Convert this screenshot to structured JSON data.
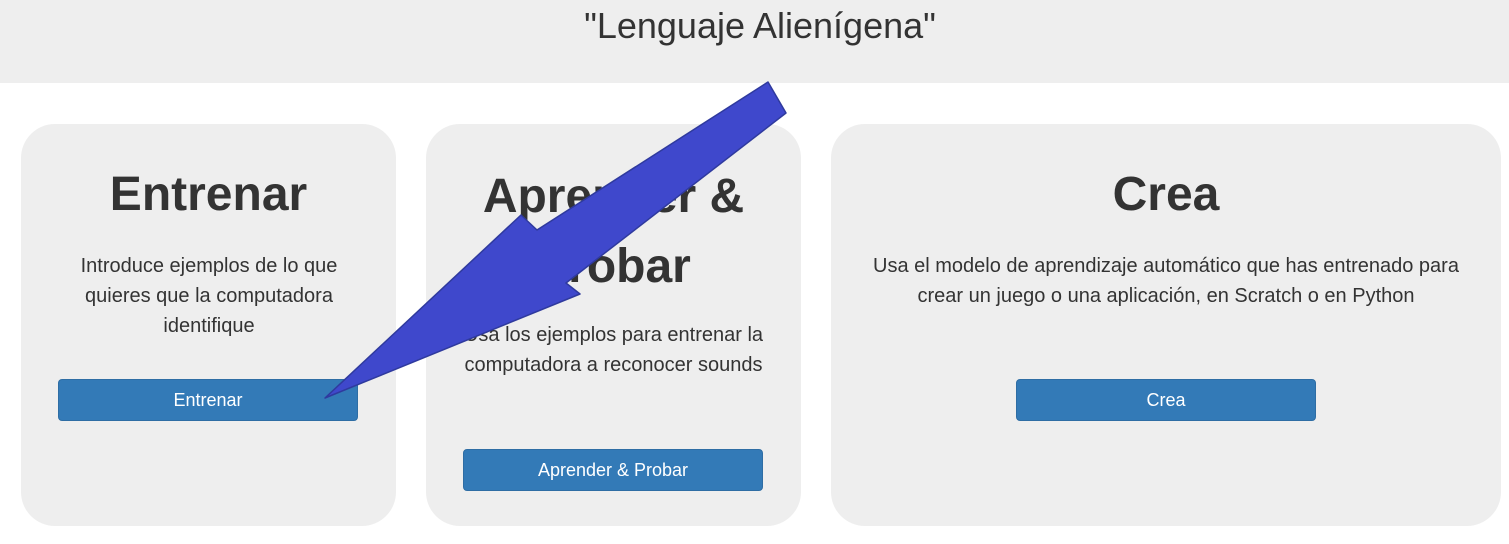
{
  "header": {
    "title": "\"Lenguaje Alienígena\""
  },
  "cards": [
    {
      "title": "Entrenar",
      "description": "Introduce ejemplos de lo que quieres que la computadora identifique",
      "button_label": "Entrenar"
    },
    {
      "title": "Aprender & Probar",
      "description": "Usa los ejemplos para entrenar la computadora a reconocer sounds",
      "button_label": "Aprender & Probar"
    },
    {
      "title": "Crea",
      "description": "Usa el modelo de aprendizaje automático que has entrenado para crear un juego o una aplicación, en Scratch o en Python",
      "button_label": "Crea"
    }
  ],
  "colors": {
    "header_background": "#eeeeee",
    "card_background": "#eeeeee",
    "button_primary": "#337ab7",
    "annotation_arrow": "#3f48cc",
    "text": "#333333"
  },
  "annotation": {
    "type": "arrow-icon",
    "points_to": "Entrenar button"
  }
}
